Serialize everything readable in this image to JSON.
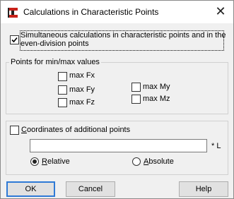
{
  "window": {
    "title": "Calculations in Characteristic Points",
    "close_glyph": "✕",
    "icon": "app-icon"
  },
  "simultaneous": {
    "line1": "Simultaneous calculations in characteristic points and in the",
    "line2": "even-division points",
    "checked": true
  },
  "minmax": {
    "group_title": "Points for min/max values",
    "items": [
      {
        "label": "max Fx",
        "checked": false
      },
      {
        "label": "max Fy",
        "checked": false
      },
      {
        "label": "max Fz",
        "checked": false
      },
      {
        "label": "max My",
        "checked": false
      },
      {
        "label": "max Mz",
        "checked": false
      }
    ]
  },
  "additional": {
    "label_prefix": "C",
    "label_rest": "oordinates of additional points",
    "checked": false,
    "input_value": "",
    "unit": "* L",
    "relative_u": "R",
    "relative_rest": "elative",
    "relative_selected": true,
    "absolute_u": "A",
    "absolute_rest": "bsolute",
    "absolute_selected": false
  },
  "buttons": {
    "ok": "OK",
    "cancel": "Cancel",
    "help": "Help"
  },
  "colors": {
    "accent": "#2f7ad6",
    "app_icon_red": "#c8221a"
  }
}
